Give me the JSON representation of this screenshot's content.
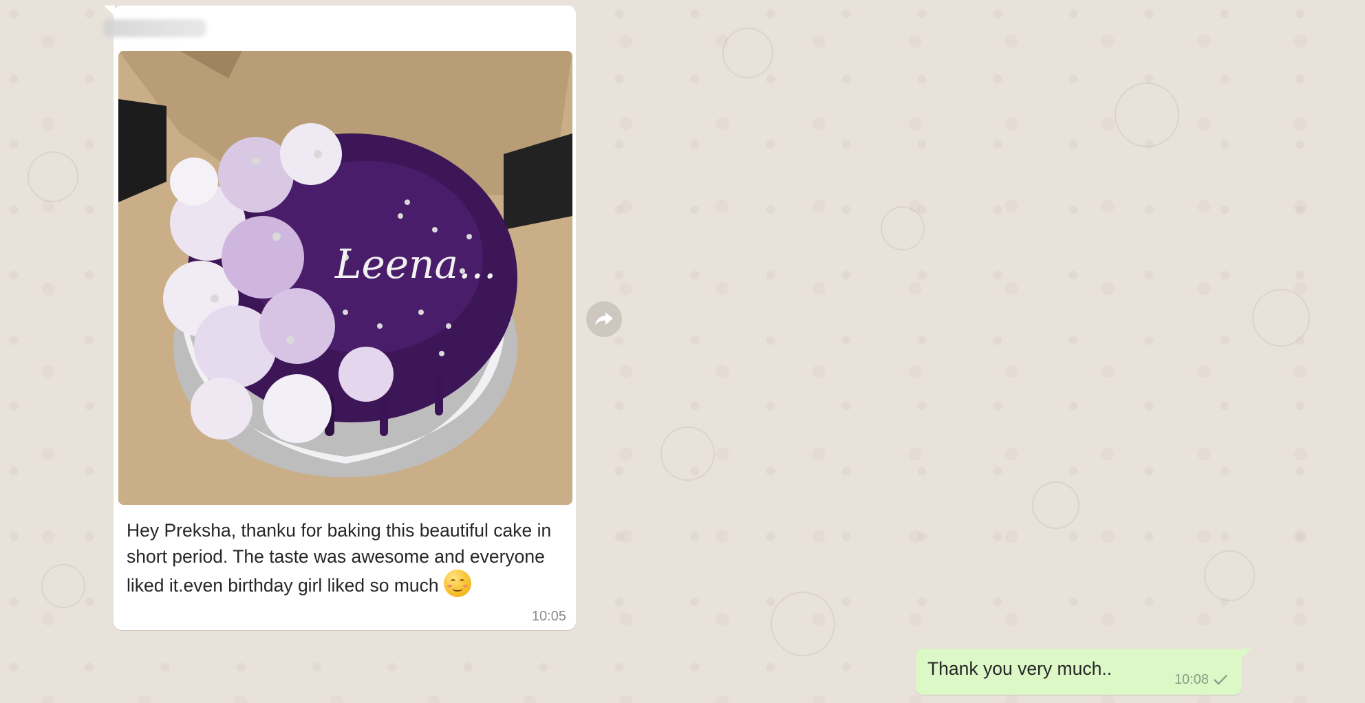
{
  "chat": {
    "messages": [
      {
        "direction": "incoming",
        "type": "image",
        "image_caption_on_cake": "Leena...",
        "text": "Hey Preksha, thanku for baking this beautiful cake in short period. The taste was awesome and everyone liked it.even birthday girl liked so much",
        "emoji": "smiling-face-with-blush",
        "time": "10:05"
      },
      {
        "direction": "outgoing",
        "type": "text",
        "text": "Thank you very much..",
        "time": "10:08",
        "status": "sent"
      }
    ]
  },
  "icons": {
    "forward": "forward-arrow-icon",
    "check": "single-check-icon"
  },
  "colors": {
    "background": "#e8e1d9",
    "incoming_bubble": "#ffffff",
    "outgoing_bubble": "#dcf8c6",
    "timestamp": "#8b8b8b",
    "forward_button": "#cdc7c0"
  }
}
